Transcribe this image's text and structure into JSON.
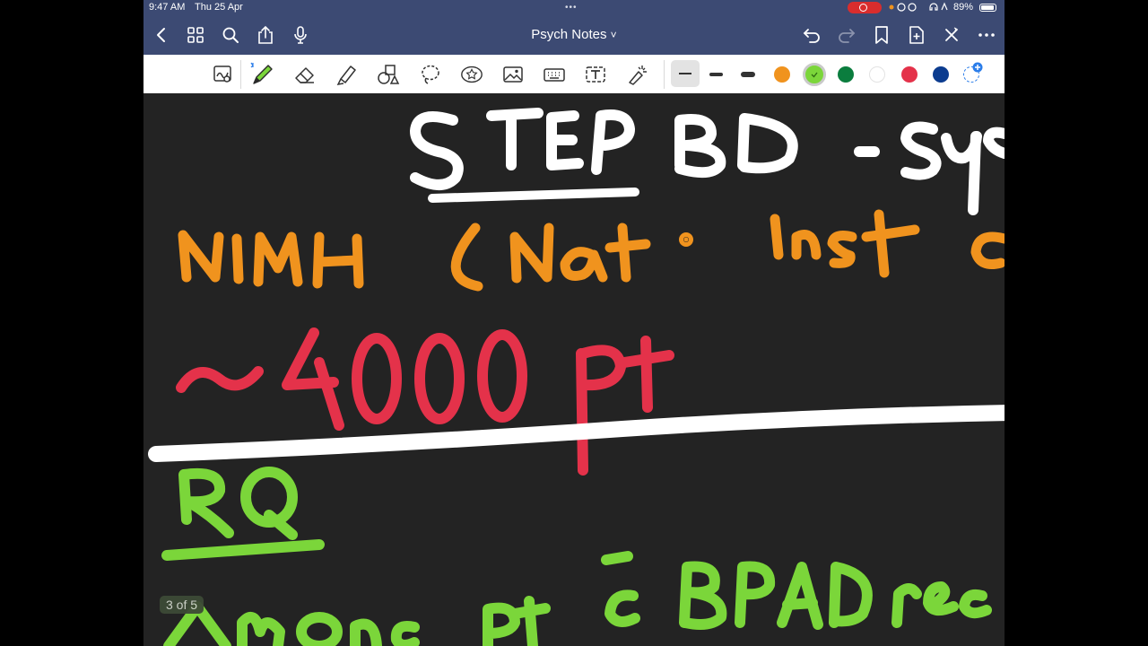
{
  "status_bar": {
    "time": "9:47 AM",
    "date": "Thu 25 Apr",
    "battery": "89%"
  },
  "nav": {
    "title": "Psych Notes",
    "title_chevron": "˅",
    "left_icons": [
      "back-icon",
      "thumbnails-icon",
      "search-icon",
      "share-icon",
      "microphone-icon"
    ],
    "right_icons": [
      "undo-icon",
      "redo-icon",
      "bookmark-icon",
      "add-page-icon",
      "close-icon",
      "more-icon"
    ]
  },
  "toolbar": {
    "tools": [
      "lasso-zoom-icon",
      "pen-icon",
      "eraser-icon",
      "highlighter-icon",
      "shapes-icon",
      "lasso-icon",
      "sticker-icon",
      "image-icon",
      "keyboard-icon",
      "text-icon",
      "laser-pointer-icon"
    ],
    "selected_tool": "pen-icon",
    "stroke_widths": [
      "thin",
      "medium",
      "thick"
    ],
    "selected_width": "thin",
    "colors": [
      "#f0931e",
      "#7bd63a",
      "#0b7d3e",
      "#ffffff",
      "#e4324a",
      "#0c3c8f"
    ],
    "selected_color": "#7bd63a"
  },
  "canvas": {
    "background": "#232323",
    "handwriting": {
      "title": "STEP BD - Sys",
      "line_orange": "NIMH ( Nat. Inst o",
      "line_red": "~ 4000 pt",
      "heading_green": "RQ",
      "line_green": "Among pt c BPAD rec"
    },
    "ink_colors": {
      "white": "#ffffff",
      "orange": "#f0931e",
      "red": "#e4324a",
      "green": "#7bd63a"
    }
  },
  "page_indicator": "3 of 5"
}
